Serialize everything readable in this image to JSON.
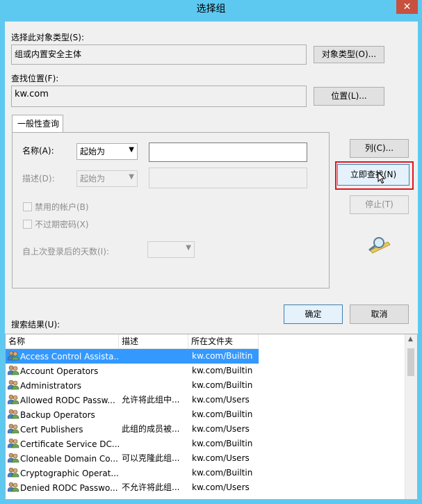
{
  "window": {
    "title": "选择组",
    "close_glyph": "✕"
  },
  "object_type": {
    "label": "选择此对象类型(S):",
    "value": "组或内置安全主体",
    "button": "对象类型(O)..."
  },
  "location": {
    "label": "查找位置(F):",
    "value": "kw.com",
    "button": "位置(L)..."
  },
  "query_tab": {
    "label": "一般性查询"
  },
  "name_row": {
    "label": "名称(A):",
    "operator": "起始为"
  },
  "desc_row": {
    "label": "描述(D):",
    "operator": "起始为"
  },
  "checkboxes": {
    "disabled_accounts": "禁用的帐户(B)",
    "non_expiring_password": "不过期密码(X)"
  },
  "days_since_logon": {
    "label": "自上次登录后的天数(I):"
  },
  "actions": {
    "columns": "列(C)...",
    "find_now": "立即查找(N)",
    "stop": "停止(T)",
    "ok": "确定",
    "cancel": "取消"
  },
  "results": {
    "label": "搜索结果(U):",
    "columns": [
      "名称",
      "描述",
      "所在文件夹"
    ],
    "rows": [
      {
        "name": "Access Control Assista...",
        "desc": "",
        "folder": "kw.com/Builtin"
      },
      {
        "name": "Account Operators",
        "desc": "",
        "folder": "kw.com/Builtin"
      },
      {
        "name": "Administrators",
        "desc": "",
        "folder": "kw.com/Builtin"
      },
      {
        "name": "Allowed RODC Passw...",
        "desc": "允许将此组中...",
        "folder": "kw.com/Users"
      },
      {
        "name": "Backup Operators",
        "desc": "",
        "folder": "kw.com/Builtin"
      },
      {
        "name": "Cert Publishers",
        "desc": "此组的成员被...",
        "folder": "kw.com/Users"
      },
      {
        "name": "Certificate Service DC...",
        "desc": "",
        "folder": "kw.com/Builtin"
      },
      {
        "name": "Cloneable Domain Co...",
        "desc": "可以克隆此组...",
        "folder": "kw.com/Users"
      },
      {
        "name": "Cryptographic Operat...",
        "desc": "",
        "folder": "kw.com/Builtin"
      },
      {
        "name": "Denied RODC Passwo...",
        "desc": "不允许将此组...",
        "folder": "kw.com/Users"
      }
    ],
    "selected_index": 0
  },
  "colors": {
    "title_bar": "#5ec9f0",
    "selection": "#3399ff",
    "highlight_box": "#e0161e"
  }
}
